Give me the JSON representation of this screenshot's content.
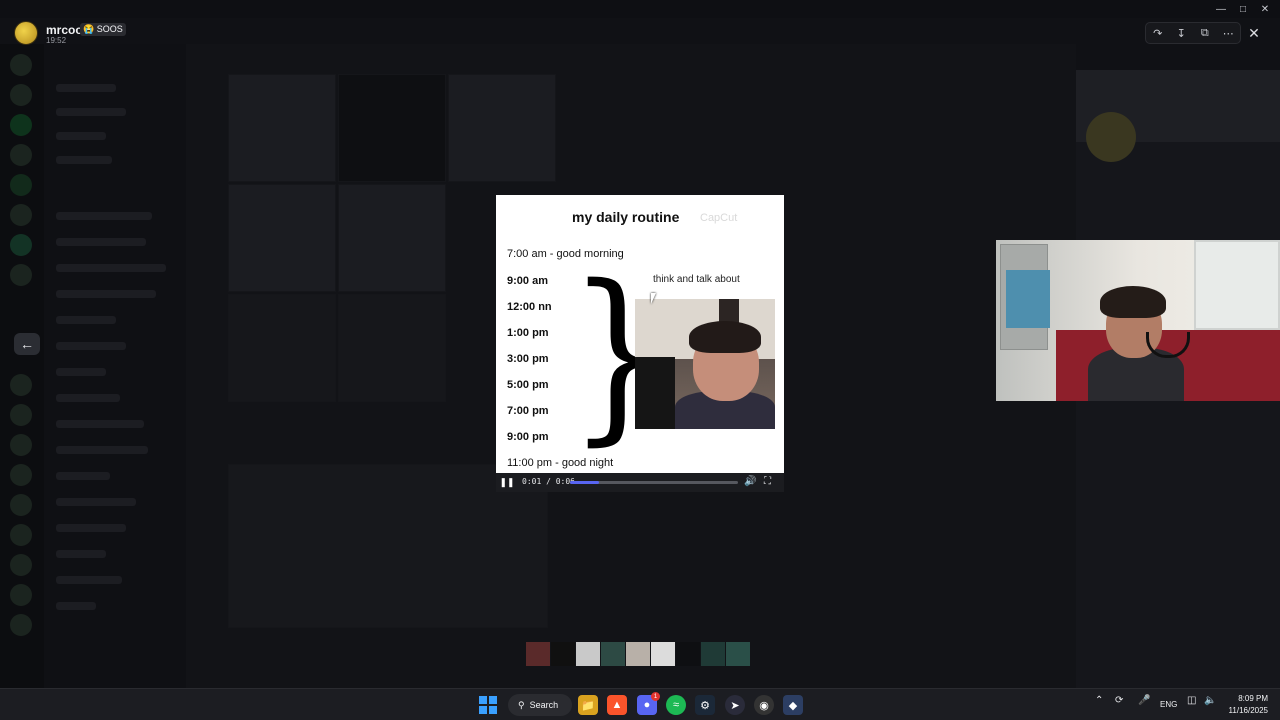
{
  "viewer": {
    "user_name": "mrcool",
    "user_tag": "😭 SOOS",
    "timestamp": "19:52"
  },
  "video": {
    "title": "my daily routine",
    "watermark": "CapCut",
    "first_line": "7:00 am - good morning",
    "times": [
      "9:00 am",
      "12:00 nn",
      "1:00 pm",
      "3:00 pm",
      "5:00 pm",
      "7:00 pm",
      "9:00 pm"
    ],
    "last_line": "11:00 pm - good night",
    "brace_label": "think and talk about",
    "player": {
      "time": "0:01 / 0:06",
      "progress": 0.17
    }
  },
  "taskbar": {
    "search_label": "Search",
    "lang": "ENG",
    "time": "8:09 PM",
    "date": "11/16/2025",
    "discord_badge": "1"
  },
  "colors": {
    "accent": "#5865f2",
    "bed": "#8e1f2b",
    "cabinet_drawers": "#4e8fae"
  }
}
